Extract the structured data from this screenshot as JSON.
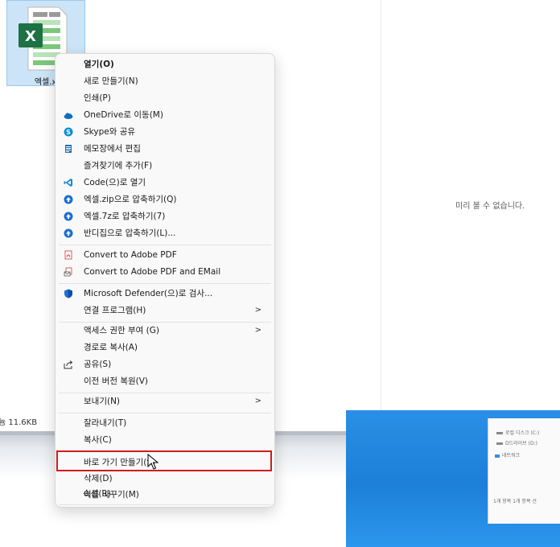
{
  "file": {
    "name": "엑셀.xl",
    "status_size": "11.6KB"
  },
  "preview_pane": {
    "message": "미리 볼 수 없습니다."
  },
  "desktop_window": {
    "drive_c": "로컬 디스크 (C:)",
    "drive_d": "D드라이브 (D:)",
    "network": "네트워크",
    "status": "1개 항목   1개 항목 선"
  },
  "context_menu": {
    "items": [
      {
        "label": "열기(O)",
        "bold": true,
        "icon": ""
      },
      {
        "label": "새로 만들기(N)",
        "icon": ""
      },
      {
        "label": "인쇄(P)",
        "icon": ""
      },
      {
        "label": "OneDrive로 이동(M)",
        "icon": "onedrive-cloud-icon"
      },
      {
        "label": "Skype와 공유",
        "icon": "skype-icon"
      },
      {
        "label": "메모장에서 편집",
        "icon": "notepad-icon"
      },
      {
        "label": "즐겨찾기에 추가(F)",
        "icon": ""
      },
      {
        "label": "Code(으)로 열기",
        "icon": "vscode-icon"
      },
      {
        "label": "엑셀.zip으로 압축하기(Q)",
        "icon": "bandizip-icon"
      },
      {
        "label": "엑셀.7z로 압축하기(7)",
        "icon": "bandizip-icon"
      },
      {
        "label": "반디집으로 압축하기(L)...",
        "icon": "bandizip-icon"
      },
      {
        "label": "Convert to Adobe PDF",
        "icon": "adobe-pdf-icon"
      },
      {
        "label": "Convert to Adobe PDF and EMail",
        "icon": "adobe-pdf-email-icon"
      },
      {
        "label": "Microsoft Defender(으)로 검사...",
        "icon": "defender-shield-icon"
      },
      {
        "label": "연결 프로그램(H)",
        "submenu": true,
        "icon": ""
      },
      {
        "label": "액세스 권한 부여 (G)",
        "submenu": true,
        "icon": ""
      },
      {
        "label": "경로로 복사(A)",
        "icon": ""
      },
      {
        "label": "공유(S)",
        "icon": "share-icon"
      },
      {
        "label": "이전 버전 복원(V)",
        "icon": ""
      },
      {
        "label": "보내기(N)",
        "submenu": true,
        "icon": ""
      },
      {
        "label": "잘라내기(T)",
        "icon": ""
      },
      {
        "label": "복사(C)",
        "icon": ""
      },
      {
        "label": "바로 가기 만들기(S)",
        "highlighted": true,
        "icon": ""
      },
      {
        "label": "삭제(D)",
        "icon": ""
      },
      {
        "label": "이름 바꾸기(M)",
        "icon": ""
      },
      {
        "label": "속성(R)",
        "icon": ""
      }
    ],
    "submenu_arrow": ">"
  },
  "highlight_color": "#d01c1c"
}
